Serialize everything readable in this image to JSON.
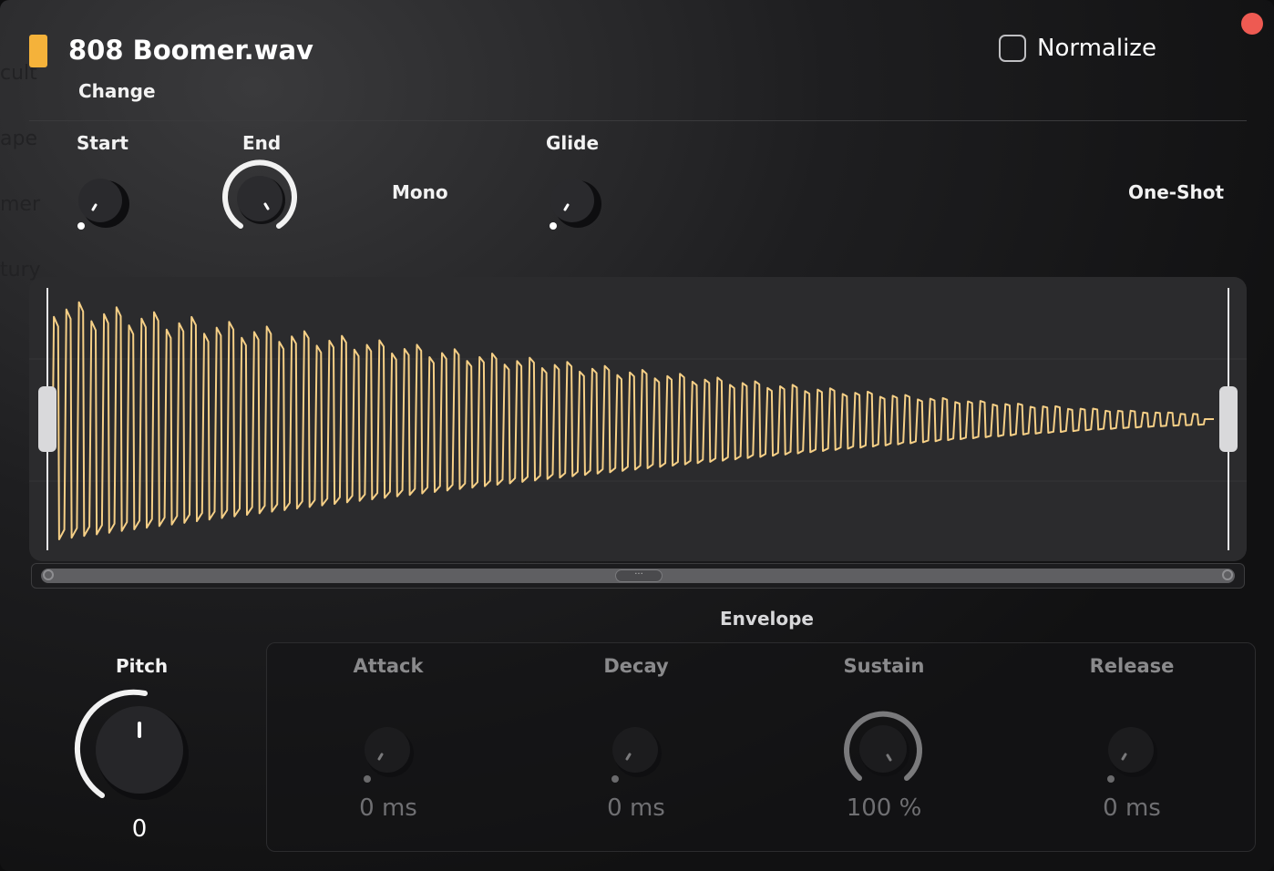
{
  "header": {
    "file_name": "808 Boomer.wav",
    "change_label": "Change",
    "normalize_label": "Normalize",
    "normalize_checked": false,
    "marker_color": "#f5b23a"
  },
  "controls": {
    "start_label": "Start",
    "end_label": "End",
    "mono_label": "Mono",
    "glide_label": "Glide",
    "oneshot_label": "One-Shot"
  },
  "waveform": {
    "color": "#f5cf86",
    "background": "#2b2b2d"
  },
  "envelope": {
    "title": "Envelope",
    "attack": {
      "label": "Attack",
      "value": "0 ms"
    },
    "decay": {
      "label": "Decay",
      "value": "0 ms"
    },
    "sustain": {
      "label": "Sustain",
      "value": "100 %"
    },
    "release": {
      "label": "Release",
      "value": "0 ms"
    }
  },
  "pitch": {
    "label": "Pitch",
    "value": "0"
  },
  "icons": [
    "close-icon",
    "checkbox-icon",
    "scroll-grip-icon"
  ]
}
